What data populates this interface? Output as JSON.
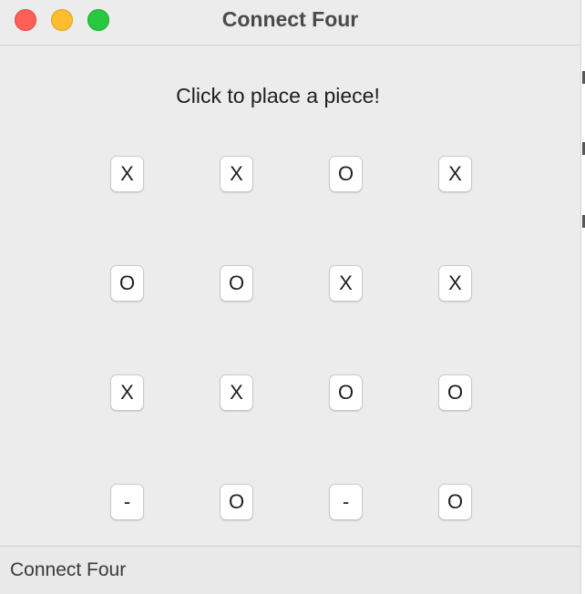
{
  "window": {
    "title": "Connect Four"
  },
  "content": {
    "prompt": "Click to place a piece!"
  },
  "board": {
    "rows": [
      [
        "X",
        "X",
        "O",
        "X"
      ],
      [
        "O",
        "O",
        "X",
        "X"
      ],
      [
        "X",
        "X",
        "O",
        "O"
      ],
      [
        "-",
        "O",
        "-",
        "O"
      ]
    ]
  },
  "statusbar": {
    "text": "Connect Four"
  },
  "colors": {
    "close": "#fe5f57",
    "minimize": "#febc2e",
    "maximize": "#28c840",
    "background": "#ececec"
  }
}
